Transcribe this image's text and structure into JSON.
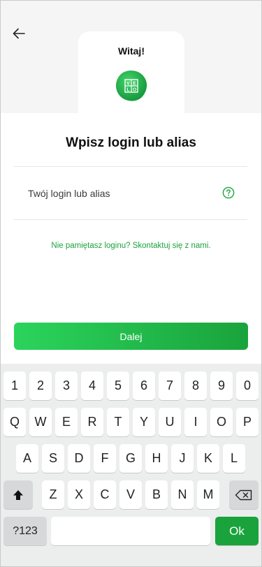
{
  "header": {
    "back_icon": "arrow-left-icon",
    "welcome_title": "Witaj!",
    "logo_icon": "velo-logo-icon",
    "logo_letters": [
      "V",
      "E",
      "L",
      "O"
    ]
  },
  "main": {
    "heading": "Wpisz login lub alias",
    "login_field": {
      "placeholder": "Twój login lub alias",
      "value": "",
      "help_icon": "question-circle-icon"
    },
    "forgot_link": "Nie pamiętasz loginu? Skontaktuj się z nami.",
    "next_button": "Dalej"
  },
  "keyboard": {
    "row1": [
      "1",
      "2",
      "3",
      "4",
      "5",
      "6",
      "7",
      "8",
      "9",
      "0"
    ],
    "row2": [
      "Q",
      "W",
      "E",
      "R",
      "T",
      "Y",
      "U",
      "I",
      "O",
      "P"
    ],
    "row3": [
      "A",
      "S",
      "D",
      "F",
      "G",
      "H",
      "J",
      "K",
      "L"
    ],
    "row4": [
      "Z",
      "X",
      "C",
      "V",
      "B",
      "N",
      "M"
    ],
    "shift_icon": "shift-arrow-icon",
    "backspace_icon": "backspace-icon",
    "symbols_label": "?123",
    "ok_label": "Ok"
  },
  "colors": {
    "accent": "#1aa33c",
    "accent_light": "#2bd45c",
    "band": "#f5f5f5",
    "keyboard_bg": "#eceded"
  }
}
